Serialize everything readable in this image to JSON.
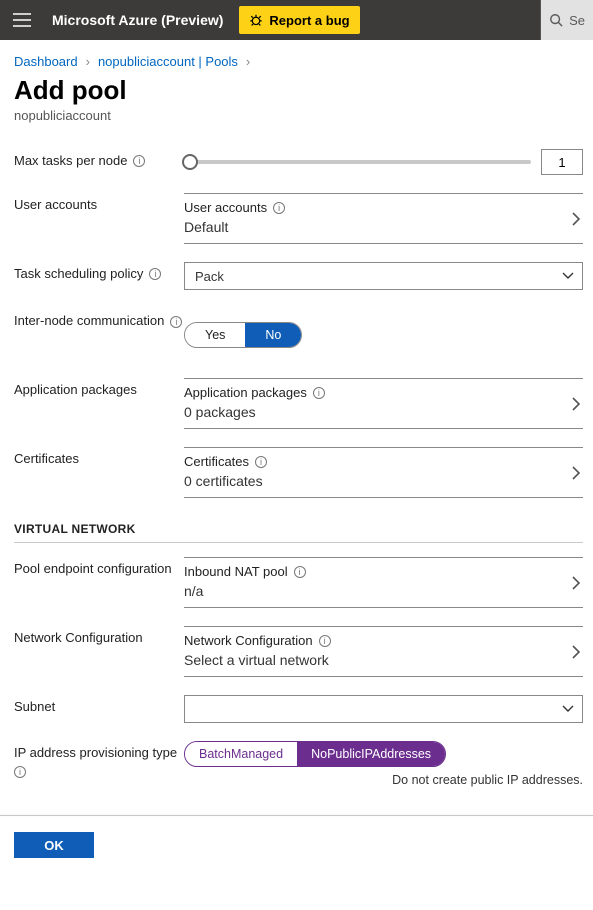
{
  "header": {
    "brand": "Microsoft Azure (Preview)",
    "report_bug": "Report a bug",
    "search_placeholder": "Se"
  },
  "breadcrumbs": {
    "dashboard": "Dashboard",
    "account_pools": "nopubliciaccount | Pools"
  },
  "page": {
    "title": "Add pool",
    "subtitle": "nopubliciaccount"
  },
  "form": {
    "max_tasks_label": "Max tasks per node",
    "max_tasks_value": "1",
    "user_accounts_label": "User accounts",
    "user_accounts_card_title": "User accounts",
    "user_accounts_value": "Default",
    "task_sched_label": "Task scheduling policy",
    "task_sched_value": "Pack",
    "inter_node_label": "Inter-node communication",
    "yes": "Yes",
    "no": "No",
    "app_pkgs_label": "Application packages",
    "app_pkgs_card_title": "Application packages",
    "app_pkgs_value": "0 packages",
    "certs_label": "Certificates",
    "certs_card_title": "Certificates",
    "certs_value": "0 certificates",
    "vnet_section": "VIRTUAL NETWORK",
    "pool_endpoint_label": "Pool endpoint configuration",
    "inbound_nat_title": "Inbound NAT pool",
    "inbound_nat_value": "n/a",
    "net_config_label": "Network Configuration",
    "net_config_title": "Network Configuration",
    "net_config_value": "Select a virtual network",
    "subnet_label": "Subnet",
    "subnet_value": "",
    "ip_prov_label": "IP address provisioning type",
    "ip_opt_batch": "BatchManaged",
    "ip_opt_nopublic": "NoPublicIPAddresses",
    "ip_hint": "Do not create public IP addresses."
  },
  "footer": {
    "ok": "OK"
  }
}
